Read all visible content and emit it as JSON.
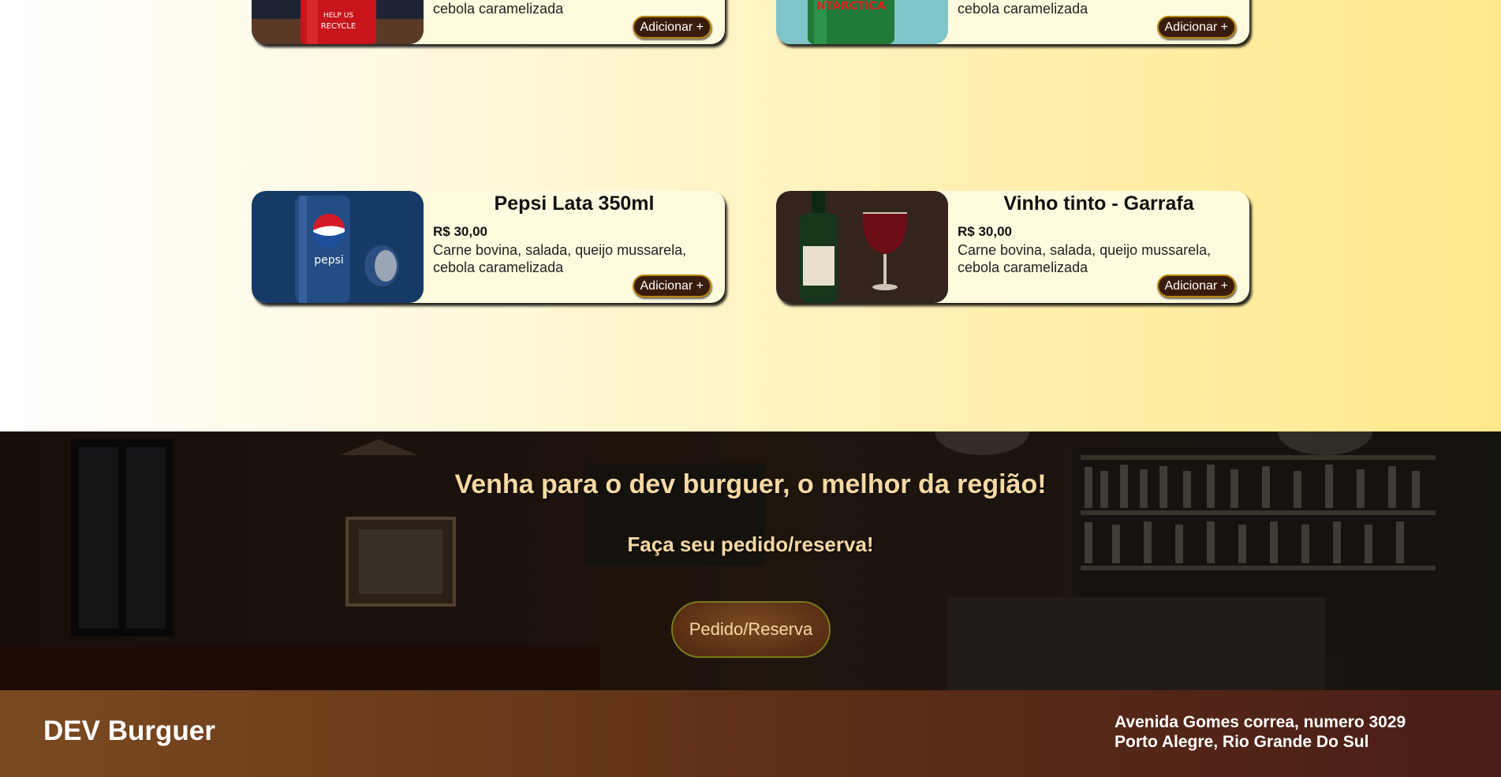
{
  "menu": {
    "items": [
      {
        "price": "",
        "desc": "cebola caramelizada",
        "button": "Adicionar +",
        "image": "coca-cola-can"
      },
      {
        "price": "",
        "desc": "cebola caramelizada",
        "button": "Adicionar +",
        "image": "guarana-antarctica-can"
      },
      {
        "title": "Pepsi Lata 350ml",
        "price": "R$ 30,00",
        "desc": "Carne bovina, salada, queijo mussarela, cebola caramelizada",
        "button": "Adicionar +",
        "image": "pepsi-can"
      },
      {
        "title": "Vinho tinto - Garrafa",
        "price": "R$ 30,00",
        "desc": "Carne bovina, salada, queijo mussarela, cebola caramelizada",
        "button": "Adicionar +",
        "image": "wine-bottle-glass"
      }
    ]
  },
  "cta": {
    "title": "Venha para o dev burguer, o melhor da região!",
    "subtitle": "Faça seu pedido/reserva!",
    "button": "Pedido/Reserva"
  },
  "footer": {
    "brand": "DEV Burguer",
    "address_line1": "Avenida Gomes correa, numero 3029",
    "address_line2": "Porto Alegre, Rio Grande Do Sul"
  },
  "colors": {
    "accent": "#3a1c0d",
    "cta_text": "#f6d9a4",
    "footer_start": "#7b4a20",
    "footer_end": "#4a1d18"
  }
}
